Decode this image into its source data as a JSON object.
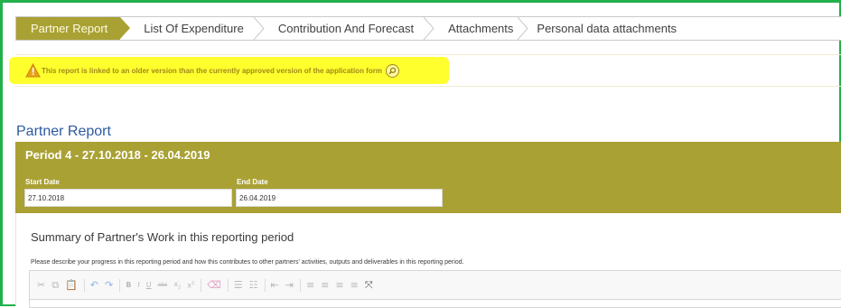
{
  "tabs": [
    {
      "label": "Partner Report",
      "active": true
    },
    {
      "label": "List Of Expenditure",
      "active": false
    },
    {
      "label": "Contribution And Forecast",
      "active": false
    },
    {
      "label": "Attachments",
      "active": false
    },
    {
      "label": "Personal data attachments",
      "active": false
    }
  ],
  "warning": {
    "text": "This report is linked to an older version than the currently approved version of the application form",
    "icon": "warning-triangle-icon",
    "info_icon": "magnifier-info-icon"
  },
  "page_title": "Partner Report",
  "period": {
    "title": "Period 4 - 27.10.2018 - 26.04.2019",
    "start_label": "Start Date",
    "start_value": "27.10.2018",
    "end_label": "End Date",
    "end_value": "26.04.2019"
  },
  "summary": {
    "title": "Summary of Partner's Work in this reporting period",
    "description": "Please describe your progress in this reporting period and how this contributes to other partners' activities, outputs and deliverables in this reporting period."
  },
  "toolbar": [
    "cut-icon",
    "copy-icon",
    "paste-text-icon",
    "undo-icon",
    "redo-icon",
    "bold-icon",
    "italic-icon",
    "underline-icon",
    "strikethrough-icon",
    "subscript-icon",
    "superscript-icon",
    "remove-format-icon",
    "numbered-list-icon",
    "bulleted-list-icon",
    "outdent-icon",
    "indent-icon",
    "align-left-icon",
    "align-center-icon",
    "align-right-icon",
    "justify-icon",
    "maximize-icon"
  ],
  "colors": {
    "accent": "#a9a134",
    "title_blue": "#2c5aa0",
    "highlight": "#ffff2e",
    "frame": "#22b04b"
  }
}
